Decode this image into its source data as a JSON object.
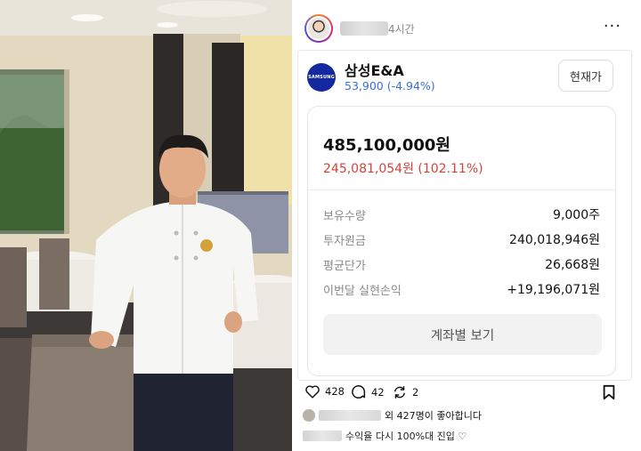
{
  "post": {
    "time_ago": "4시간",
    "more_glyph": "···"
  },
  "stock": {
    "logo_text": "SAMSUNG",
    "name": "삼성E&A",
    "price_change": "53,900 (-4.94%)",
    "current_price_button": "현재가",
    "evaluation_amount": "485,100,000원",
    "profit": "245,081,054원 (102.11%)",
    "rows": [
      {
        "label": "보유수량",
        "value": "9,000주"
      },
      {
        "label": "투자원금",
        "value": "240,018,946원"
      },
      {
        "label": "평균단가",
        "value": "26,668원"
      },
      {
        "label": "이번달 실현손익",
        "value": "+19,196,071원"
      }
    ],
    "account_view_button": "계좌별 보기"
  },
  "actions": {
    "likes_count": "428",
    "comments_count": "42",
    "reposts_count": "2"
  },
  "likes_text": "외 427명이 좋아합니다",
  "caption": "수익율 다시 100%대 진입 ♡",
  "colors": {
    "price_blue": "#3a6fd8",
    "profit_red": "#d0443c",
    "samsung_blue": "#1428a0"
  }
}
